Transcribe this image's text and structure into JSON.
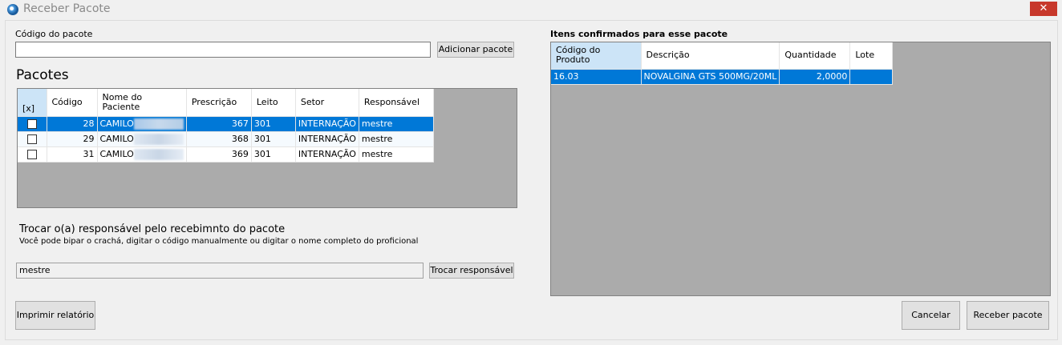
{
  "window": {
    "title": "Receber Pacote",
    "close_glyph": "✕"
  },
  "left": {
    "package_code_label": "Código do pacote",
    "package_code_value": "",
    "add_button": "Adicionar pacote",
    "packages_title": "Pacotes",
    "packages_table": {
      "headers": [
        "[x]",
        "Código",
        "Nome do Paciente",
        "Prescrição",
        "Leito",
        "Setor",
        "Responsável"
      ],
      "rows": [
        {
          "checked": false,
          "codigo": "28",
          "nome": "CAMILO",
          "prescricao": "367",
          "leito": "301",
          "setor": "INTERNAÇÃO",
          "responsavel": "mestre",
          "selected": true
        },
        {
          "checked": false,
          "codigo": "29",
          "nome": "CAMILO",
          "prescricao": "368",
          "leito": "301",
          "setor": "INTERNAÇÃO",
          "responsavel": "mestre",
          "selected": false
        },
        {
          "checked": false,
          "codigo": "31",
          "nome": "CAMILO",
          "prescricao": "369",
          "leito": "301",
          "setor": "INTERNAÇÃO",
          "responsavel": "mestre",
          "selected": false
        }
      ]
    },
    "change_title": "Trocar o(a) responsável pelo recebimnto do pacote",
    "change_hint": "Você pode bipar o crachá, digitar o código manualmente ou digitar o nome completo do proficional",
    "responsavel_value": "mestre",
    "change_button": "Trocar responsável",
    "print_button": "Imprimir relatório"
  },
  "right": {
    "items_title": "Itens confirmados para esse pacote",
    "items_table": {
      "headers": [
        "Código do Produto",
        "Descrição",
        "Quantidade",
        "Lote"
      ],
      "rows": [
        {
          "codigo": "16.03",
          "descricao": "NOVALGINA GTS 500MG/20ML",
          "quantidade": "2,0000",
          "lote": "",
          "selected": true
        }
      ]
    },
    "cancel_button": "Cancelar",
    "receive_button": "Receber pacote"
  },
  "icons": {
    "app": "app-orb-icon",
    "close": "close-icon"
  },
  "colors": {
    "selection": "#0078d7",
    "grid_background": "#ababab",
    "close_button": "#c7382b"
  }
}
